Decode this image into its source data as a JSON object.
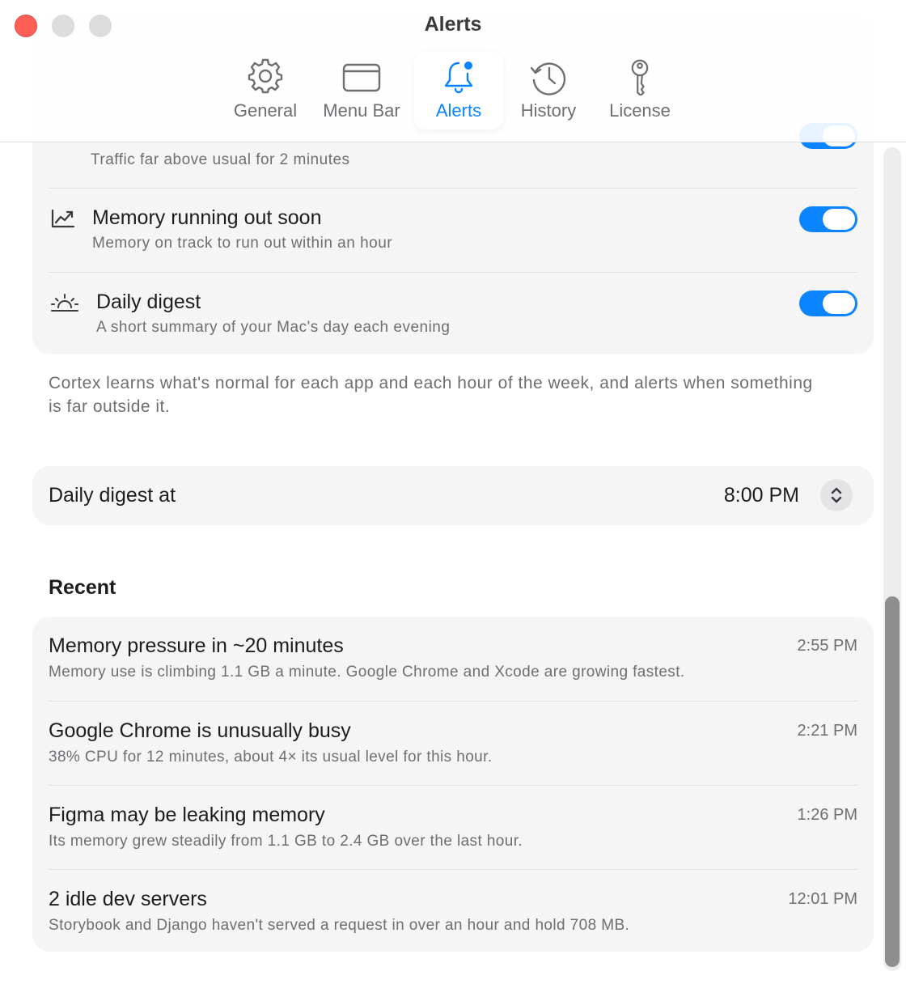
{
  "window": {
    "title": "Alerts"
  },
  "tabs": [
    {
      "label": "General",
      "icon": "gear-icon"
    },
    {
      "label": "Menu Bar",
      "icon": "window-icon"
    },
    {
      "label": "Alerts",
      "icon": "bell-icon",
      "active": true
    },
    {
      "label": "History",
      "icon": "clock-history-icon"
    },
    {
      "label": "License",
      "icon": "key-icon"
    }
  ],
  "alert_types": [
    {
      "title": "",
      "subtitle": "Traffic far above usual for 2 minutes",
      "enabled": true
    },
    {
      "title": "Memory running out soon",
      "subtitle": "Memory on track to run out within an hour",
      "icon": "chart-trend-icon",
      "enabled": true
    },
    {
      "title": "Daily digest",
      "subtitle": "A short summary of your Mac's day each evening",
      "icon": "sunset-icon",
      "enabled": true
    }
  ],
  "footnote": "Cortex learns what's normal for each app and each hour of the week, and alerts when something is far outside it.",
  "digest": {
    "label": "Daily digest at",
    "time": "8:00 PM"
  },
  "recent": {
    "heading": "Recent",
    "items": [
      {
        "title": "Memory pressure in ~20 minutes",
        "detail": "Memory use is climbing 1.1 GB a minute. Google Chrome and Xcode are growing fastest.",
        "time": "2:55 PM"
      },
      {
        "title": "Google Chrome is unusually busy",
        "detail": "38% CPU for 12 minutes, about 4× its usual level for this hour.",
        "time": "2:21 PM"
      },
      {
        "title": "Figma may be leaking memory",
        "detail": "Its memory grew steadily from 1.1 GB to 2.4 GB over the last hour.",
        "time": "1:26 PM"
      },
      {
        "title": "2 idle dev servers",
        "detail": "Storybook and Django haven't served a request in over an hour and hold 708 MB.",
        "time": "12:01 PM"
      }
    ]
  },
  "colors": {
    "accent": "#0a84ff",
    "close": "#ff5f57",
    "card": "#f5f5f5",
    "secondary_text": "#6e6e73"
  }
}
